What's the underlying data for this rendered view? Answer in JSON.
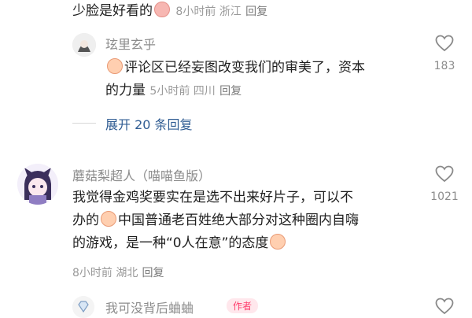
{
  "top_comment": {
    "text": "少脸是好看的",
    "meta": "8小时前 浙江",
    "reply": "回复"
  },
  "reply1": {
    "username": "玹里玄乎",
    "text_line1": "评论区已经妄图改变我们的审美了，资本",
    "text_line2": "的力量",
    "meta": "5小时前 四川",
    "reply": "回复",
    "likes": "183"
  },
  "expand_replies": "展开 20 条回复",
  "comment2": {
    "username": "蘑菇梨超人（喵喵鱼版）",
    "line1": "我觉得金鸡奖要实在是选不出来好片子，可以不",
    "line2": "办的",
    "line2b": "中国普通老百姓绝大部分对这种圈内自嗨",
    "line3": "的游戏，是一种“0人在意”的态度",
    "meta": "8小时前 湖北",
    "reply": "回复",
    "likes": "1021"
  },
  "comment3": {
    "username": "我可没背后蛐蛐",
    "badge": "作者"
  }
}
